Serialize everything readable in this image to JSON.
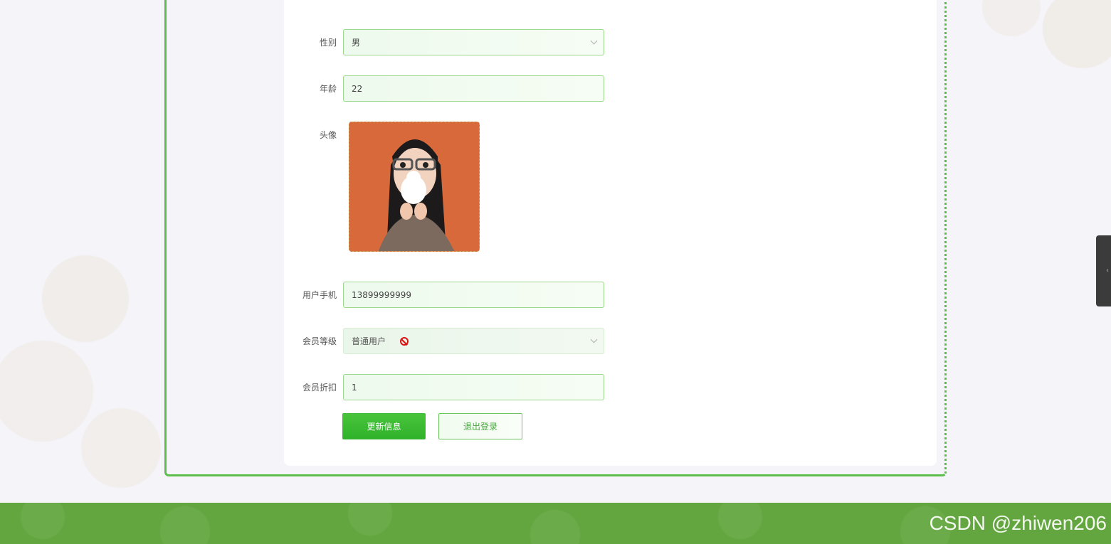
{
  "form": {
    "gender": {
      "label": "性别",
      "value": "男"
    },
    "age": {
      "label": "年龄",
      "value": "22"
    },
    "avatar": {
      "label": "头像"
    },
    "phone": {
      "label": "用户手机",
      "value": "13899999999"
    },
    "member_level": {
      "label": "会员等级",
      "value": "普通用户"
    },
    "discount": {
      "label": "会员折扣",
      "value": "1"
    }
  },
  "buttons": {
    "update": "更新信息",
    "logout": "退出登录"
  },
  "watermark": "CSDN @zhiwen206",
  "colors": {
    "accent": "#5cbf4c",
    "primary_button": "#38b832",
    "footer": "#63a63f"
  }
}
